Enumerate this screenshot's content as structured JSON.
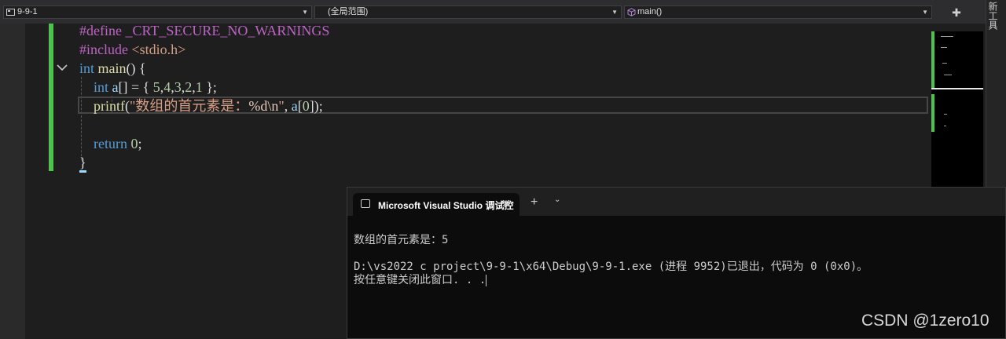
{
  "navbar": {
    "project_combo": "9-9-1",
    "scope_combo": "(全局范围)",
    "member_combo": "main()",
    "side_panel_label": "新工具"
  },
  "editor": {
    "lines": [
      "#define _CRT_SECURE_NO_WARNINGS",
      "#include <stdio.h>",
      "int main() {",
      "    int a[] = { 5,4,3,2,1 };",
      "    printf(\"数组的首元素是：%d\\n\", a[0]);",
      "",
      "    return 0;",
      "}"
    ]
  },
  "terminal": {
    "tab_title": "Microsoft Visual Studio 调试控",
    "output": [
      "数组的首元素是：5",
      "",
      "D:\\vs2022 c project\\9-9-1\\x64\\Debug\\9-9-1.exe (进程 9952)已退出，代码为 0 (0x0)。",
      "按任意键关闭此窗口. . ."
    ]
  },
  "watermark": "CSDN @1zero10",
  "colors": {
    "change_bar": "#4ec14e",
    "keyword": "#569cd6",
    "macro": "#bd63c5",
    "string": "#d69d85"
  },
  "icons": [
    "class-icon",
    "cube-icon",
    "split-icon",
    "fold-chevron-icon",
    "terminal-icon",
    "close-icon",
    "plus-icon",
    "chevron-down-icon"
  ]
}
